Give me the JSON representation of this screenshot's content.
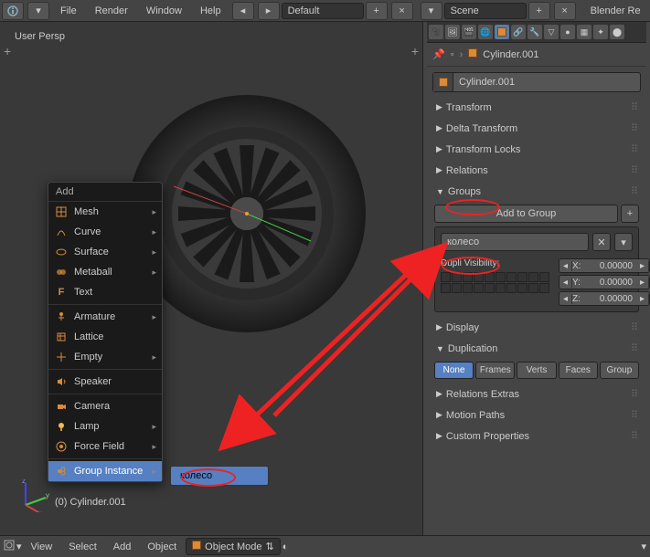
{
  "top": {
    "file": "File",
    "render": "Render",
    "window": "Window",
    "help": "Help",
    "layout": "Default",
    "scene_label": "Scene",
    "engine": "Blender Re"
  },
  "viewport": {
    "persp": "User Persp",
    "object": "(0) Cylinder.001"
  },
  "addmenu": {
    "title": "Add",
    "mesh": "Mesh",
    "curve": "Curve",
    "surface": "Surface",
    "metaball": "Metaball",
    "text": "Text",
    "armature": "Armature",
    "lattice": "Lattice",
    "empty": "Empty",
    "speaker": "Speaker",
    "camera": "Camera",
    "lamp": "Lamp",
    "forcefield": "Force Field",
    "groupinst": "Group Instance",
    "submenu": "колесо"
  },
  "props": {
    "crumb": "Cylinder.001",
    "obj_name": "Cylinder.001",
    "panels": {
      "transform": "Transform",
      "deltatrans": "Delta Transform",
      "translocks": "Transform Locks",
      "relations": "Relations",
      "groups": "Groups",
      "display": "Display",
      "duplication": "Duplication",
      "relextras": "Relations Extras",
      "motionpaths": "Motion Paths",
      "customprops": "Custom Properties"
    },
    "addtogroup": "Add to Group",
    "group_name": "колесо",
    "dupli_vis": "Dupli Visibility:",
    "coords": {
      "x": "X:",
      "y": "Y:",
      "z": "Z:",
      "xv": "0.00000",
      "yv": "0.00000",
      "zv": "0.00000"
    },
    "dupl": {
      "none": "None",
      "frames": "Frames",
      "verts": "Verts",
      "faces": "Faces",
      "group": "Group"
    }
  },
  "bottom": {
    "view": "View",
    "select": "Select",
    "add": "Add",
    "object": "Object",
    "mode": "Object Mode"
  }
}
